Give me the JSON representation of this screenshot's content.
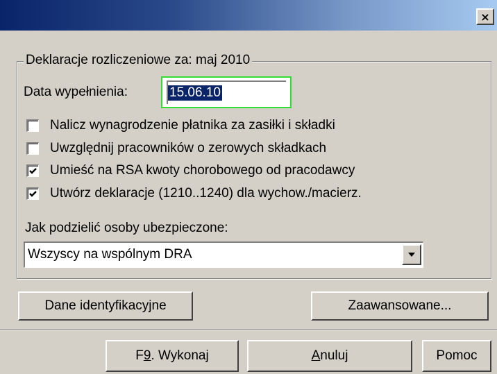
{
  "window": {
    "title": "",
    "close_label": "×"
  },
  "group": {
    "legend": "Deklaracje rozliczeniowe za: maj 2010"
  },
  "date": {
    "label": "Data wypełnienia:",
    "value": "15.06.10"
  },
  "options": [
    {
      "label": "Nalicz wynagrodzenie płatnika za zasiłki i składki",
      "checked": false
    },
    {
      "label": "Uwzględnij pracowników o zerowych składkach",
      "checked": false
    },
    {
      "label": "Umieść na RSA kwoty chorobowego od pracodawcy",
      "checked": true
    },
    {
      "label": "Utwórz deklaracje (1210..1240) dla wychow./macierz.",
      "checked": true
    }
  ],
  "split": {
    "label": "Jak podzielić osoby ubezpieczone:",
    "selected": "Wszyscy na wspólnym DRA"
  },
  "buttons": {
    "identification": "Dane identyfikacyjne",
    "advanced": "Zaawansowane...",
    "execute_prefix": "F",
    "execute_key": "9",
    "execute_rest": ". Wykonaj",
    "cancel_key": "A",
    "cancel_rest": "nuluj",
    "help": "Pomoc"
  }
}
